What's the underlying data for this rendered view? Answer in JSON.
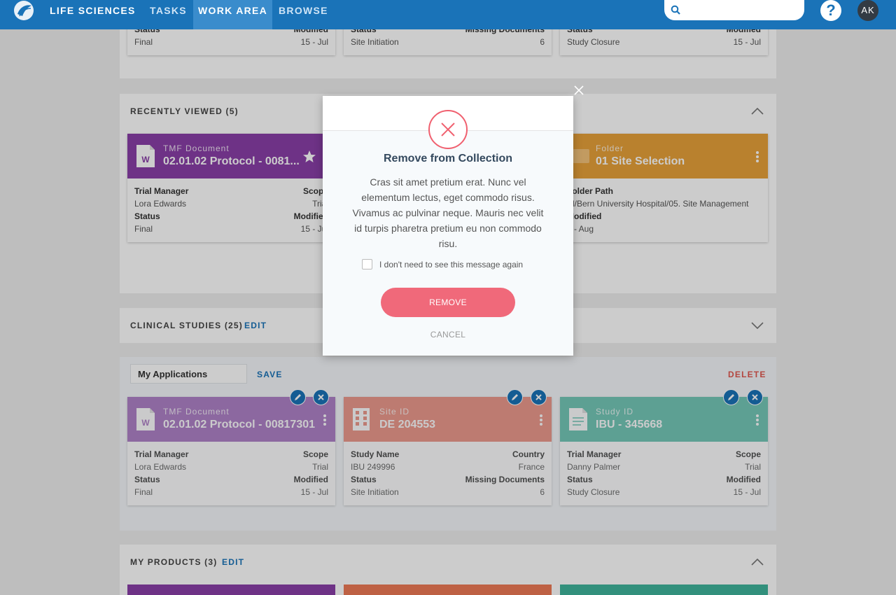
{
  "nav": {
    "brand": "LIFE SCIENCES",
    "tabs": [
      {
        "label": "TASKS"
      },
      {
        "label": "WORK AREA"
      },
      {
        "label": "BROWSE"
      }
    ],
    "help": "?",
    "avatar": "AK"
  },
  "top_cards": [
    {
      "r1l": "Status",
      "r1r": "Modified",
      "r2l": "Final",
      "r2r": "15 - Jul"
    },
    {
      "r1l": "Status",
      "r1r": "Missing Documents",
      "r2l": "Site Initiation",
      "r2r": "6"
    },
    {
      "r1l": "Status",
      "r1r": "Modified",
      "r2l": "Study Closure",
      "r2r": "15 - Jul"
    }
  ],
  "recent": {
    "title": "RECENTLY VIEWED (5)",
    "cards": [
      {
        "type": "TMF Document",
        "title": "02.01.02 Protocol - 0081...",
        "icon": "W",
        "rows": [
          [
            "Trial Manager",
            "Scope"
          ],
          [
            "Lora Edwards",
            "Trial"
          ],
          [
            "Status",
            "Modified"
          ],
          [
            "Final",
            "15 - Jul"
          ]
        ]
      },
      {
        "type": "Folder",
        "title": "01 Site Selection",
        "rows": [
          [
            "Folder Path",
            ""
          ],
          [
            "rd/Bern University Hospital/05. Site Management",
            ""
          ],
          [
            "Modified",
            ""
          ],
          [
            "3 - Aug",
            ""
          ]
        ]
      }
    ]
  },
  "clinical": {
    "title": "CLINICAL STUDIES (25)",
    "edit": "EDIT"
  },
  "apps": {
    "input_value": "My Applications",
    "save": "SAVE",
    "delete": "DELETE",
    "cards": [
      {
        "type": "TMF Document",
        "title": "02.01.02 Protocol - 00817301",
        "icon": "W",
        "rows": [
          [
            "Trial Manager",
            "Scope"
          ],
          [
            "Lora Edwards",
            "Trial"
          ],
          [
            "Status",
            "Modified"
          ],
          [
            "Final",
            "15 - Jul"
          ]
        ]
      },
      {
        "type": "Site ID",
        "title": "DE 204553",
        "rows": [
          [
            "Study Name",
            "Country"
          ],
          [
            "IBU 249996",
            "France"
          ],
          [
            "Status",
            "Missing Documents"
          ],
          [
            "Site Initiation",
            "6"
          ]
        ]
      },
      {
        "type": "Study ID",
        "title": "IBU - 345668",
        "rows": [
          [
            "Trial Manager",
            "Scope"
          ],
          [
            "Danny Palmer",
            "Trial"
          ],
          [
            "Status",
            "Modified"
          ],
          [
            "Study Closure",
            "15 - Jul"
          ]
        ]
      }
    ]
  },
  "products": {
    "title": "MY PRODUCTS (3)",
    "edit": "EDIT"
  },
  "modal": {
    "title": "Remove from Collection",
    "body": "Cras sit amet pretium erat. Nunc vel elementum lectus, eget commodo risus. Vivamus ac pulvinar neque. Mauris nec velit id turpis pharetra pretium eu non commodo risu.",
    "checkbox_label": "I don't need to see this message again",
    "remove": "REMOVE",
    "cancel": "CANCEL"
  },
  "colors": {
    "nav": "#1a73b8",
    "purple": "#8a3fa8",
    "orange": "#e8a23a",
    "salmon": "#ec8a7c",
    "teal": "#5fc1ad",
    "accent_red": "#f0697a"
  }
}
